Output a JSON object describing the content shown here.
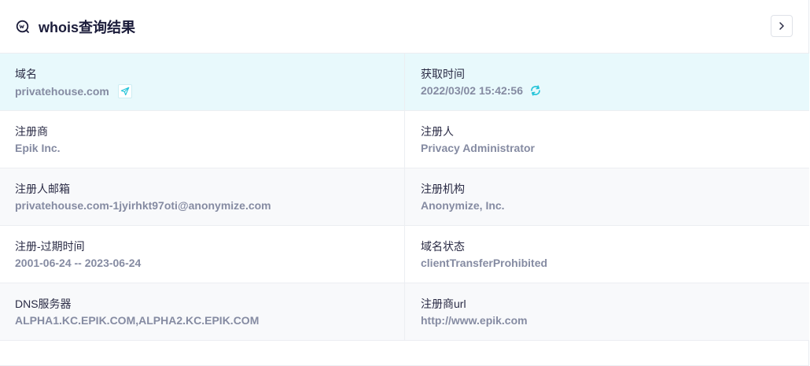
{
  "header": {
    "title": "whois查询结果"
  },
  "rows": [
    {
      "left": {
        "label": "域名",
        "value": "privatehouse.com"
      },
      "right": {
        "label": "获取时间",
        "value": "2022/03/02 15:42:56"
      }
    },
    {
      "left": {
        "label": "注册商",
        "value": "Epik Inc."
      },
      "right": {
        "label": "注册人",
        "value": "Privacy Administrator"
      }
    },
    {
      "left": {
        "label": "注册人邮箱",
        "value": "privatehouse.com-1jyirhkt97oti@anonymize.com"
      },
      "right": {
        "label": "注册机构",
        "value": "Anonymize, Inc."
      }
    },
    {
      "left": {
        "label": "注册-过期时间",
        "value": "2001-06-24 -- 2023-06-24"
      },
      "right": {
        "label": "域名状态",
        "value": "clientTransferProhibited"
      }
    },
    {
      "left": {
        "label": "DNS服务器",
        "value": "ALPHA1.KC.EPIK.COM,ALPHA2.KC.EPIK.COM"
      },
      "right": {
        "label": "注册商url",
        "value": "http://www.epik.com"
      }
    }
  ],
  "colors": {
    "highlight_row": "#e8f9fc",
    "alt_row": "#f8f9fb",
    "accent": "#22c3d8",
    "title": "#1b1c3a",
    "value": "#858ba2"
  },
  "icons": {
    "header": "whois-logo-icon",
    "next": "chevron-right-icon",
    "visit": "send-arrow-icon",
    "refresh": "refresh-icon"
  }
}
